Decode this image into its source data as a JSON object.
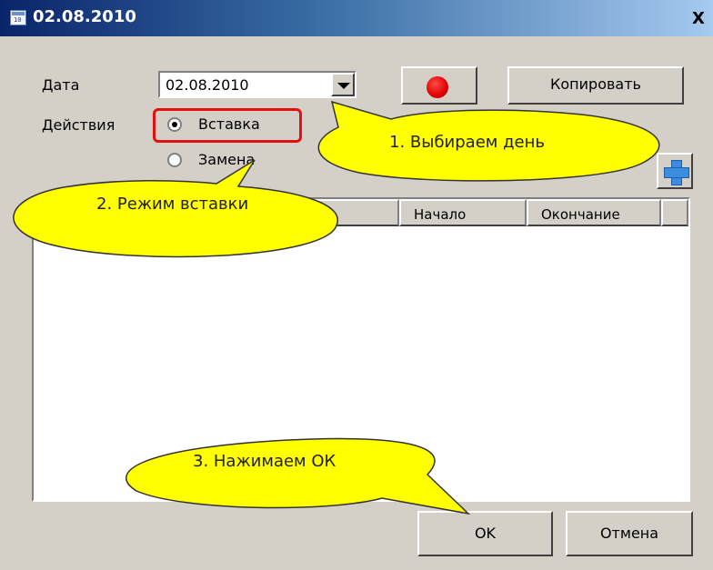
{
  "window": {
    "title": "02.08.2010",
    "close_label": "X"
  },
  "form": {
    "date_label": "Дата",
    "date_value": "02.08.2010",
    "actions_label": "Действия",
    "radio_insert": "Вставка",
    "radio_replace": "Замена",
    "copy_button": "Копировать"
  },
  "table": {
    "columns": [
      "",
      "",
      "Начало",
      "Окончание"
    ]
  },
  "buttons": {
    "ok": "OK",
    "cancel": "Отмена"
  },
  "callouts": {
    "step1": "1. Выбираем день",
    "step2": "2. Режим вставки",
    "step3": "3. Нажимаем ОК"
  },
  "colors": {
    "title_gradient_start": "#0a246a",
    "face": "#d4d0c8",
    "callout_fill": "#ffff00",
    "highlight": "#e31010",
    "record": "#e00000"
  }
}
